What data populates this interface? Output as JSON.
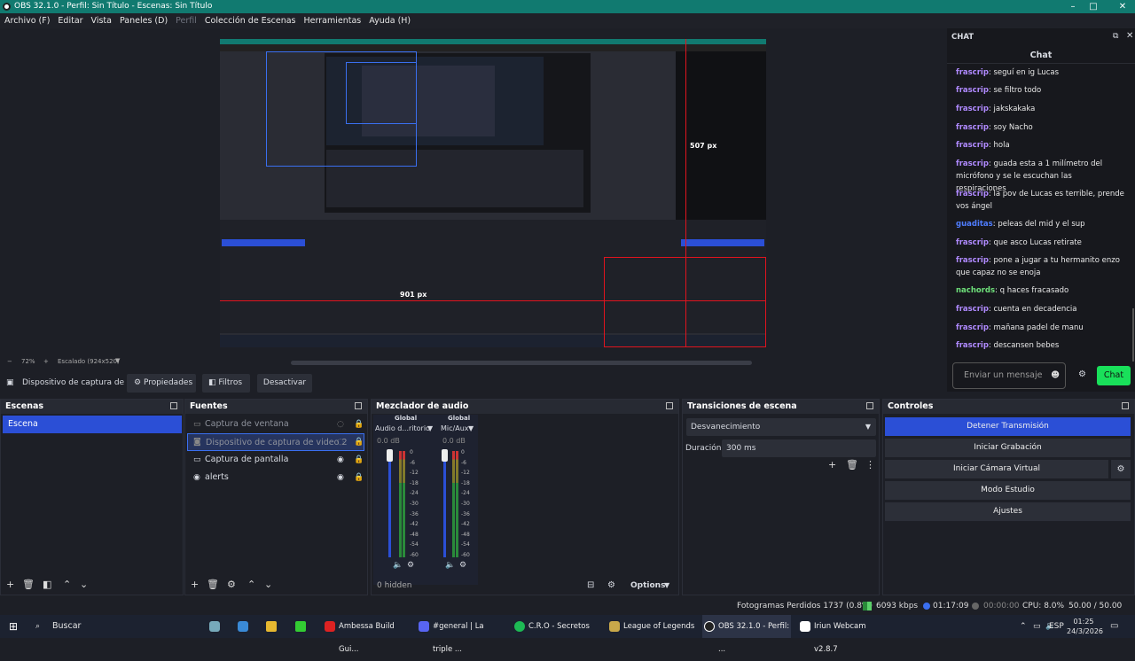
{
  "window": {
    "title": "OBS 32.1.0 - Perfil: Sin Título - Escenas: Sin Título",
    "minimize": "–",
    "maximize": "□",
    "close": "✕"
  },
  "menu": [
    "Archivo (F)",
    "Editar",
    "Vista",
    "Paneles (D)",
    "Perfil",
    "Colección de Escenas",
    "Herramientas",
    "Ayuda (H)"
  ],
  "preview": {
    "zoom": "72%",
    "scale_label": "Escalado (924x520)",
    "label_w": "507 px",
    "label_h": "901 px"
  },
  "source_toolbar": {
    "source_name": "Dispositivo de captura de v",
    "properties": "Propiedades",
    "filters": "Filtros",
    "deactivate": "Desactivar"
  },
  "scenes": {
    "title": "Escenas",
    "items": [
      "Escena"
    ]
  },
  "sources": {
    "title": "Fuentes",
    "items": [
      "Captura de ventana",
      "Dispositivo de captura de video 2",
      "Captura de pantalla",
      "alerts"
    ]
  },
  "mixer": {
    "title": "Mezclador de audio",
    "channels": [
      {
        "group": "Global",
        "name": "Audio d...ritorio",
        "db": "0.0 dB"
      },
      {
        "group": "Global",
        "name": "Mic/Aux",
        "db": "0.0 dB"
      }
    ],
    "scale": [
      "0",
      "-6",
      "-12",
      "-18",
      "-24",
      "-30",
      "-36",
      "-42",
      "-48",
      "-54",
      "-60"
    ],
    "hidden": "0 hidden",
    "options": "Options"
  },
  "transitions": {
    "title": "Transiciones de escena",
    "selected": "Desvanecimiento",
    "duration_label": "Duración",
    "duration_value": "300 ms"
  },
  "controls": {
    "title": "Controles",
    "stop_stream": "Detener Transmisión",
    "start_record": "Iniciar Grabación",
    "start_vcam": "Iniciar Cámara Virtual",
    "studio_mode": "Modo Estudio",
    "settings": "Ajustes"
  },
  "chat": {
    "dock_title": "CHAT",
    "header": "Chat",
    "placeholder": "Enviar un mensaje",
    "send": "Chat",
    "messages": [
      {
        "user": "frascrip",
        "text": "seguí en ig Lucas"
      },
      {
        "user": "frascrip",
        "text": "se filtro todo"
      },
      {
        "user": "frascrip",
        "text": "jakskakaka"
      },
      {
        "user": "frascrip",
        "text": "soy Nacho"
      },
      {
        "user": "frascrip",
        "text": "hola"
      },
      {
        "user": "frascrip",
        "text": "guada esta a 1 milímetro del micrófono y se le escuchan las respiraciones"
      },
      {
        "user": "frascrip",
        "text": "la pov de Lucas es terrible, prende vos ángel"
      },
      {
        "user": "guaditas",
        "text": "peleas del mid y el sup"
      },
      {
        "user": "frascrip",
        "text": "que asco Lucas retirate"
      },
      {
        "user": "frascrip",
        "text": "pone a jugar a tu hermanito enzo que capaz no se enoja"
      },
      {
        "user": "nachords",
        "text": "q haces fracasado"
      },
      {
        "user": "frascrip",
        "text": "cuenta en decadencia"
      },
      {
        "user": "frascrip",
        "text": "mañana padel de manu"
      },
      {
        "user": "frascrip",
        "text": "descansen bebes"
      }
    ]
  },
  "colors": {
    "frascrip": "#b08aff",
    "guaditas": "#4f7dff",
    "nachords": "#6ee07a",
    "accent": "#2b4fd6",
    "send": "#19e05a"
  },
  "status": {
    "dropped": "Fotogramas Perdidos 1737 (0.8%)",
    "bitrate": "6093 kbps",
    "stream_time": "01:17:09",
    "rec_time": "00:00:00",
    "cpu": "CPU: 8.0%",
    "fps": "50.00 / 50.00 FPS"
  },
  "taskbar": {
    "search": "Buscar",
    "apps": [
      "Ambessa Build Gui...",
      "#general | La triple ...",
      "C.R.O - Secretos",
      "League of Legends",
      "OBS 32.1.0 - Perfil: ...",
      "Iriun Webcam v2.8.7"
    ],
    "lang": "ESP",
    "time": "01:25",
    "date": "24/3/2026"
  }
}
